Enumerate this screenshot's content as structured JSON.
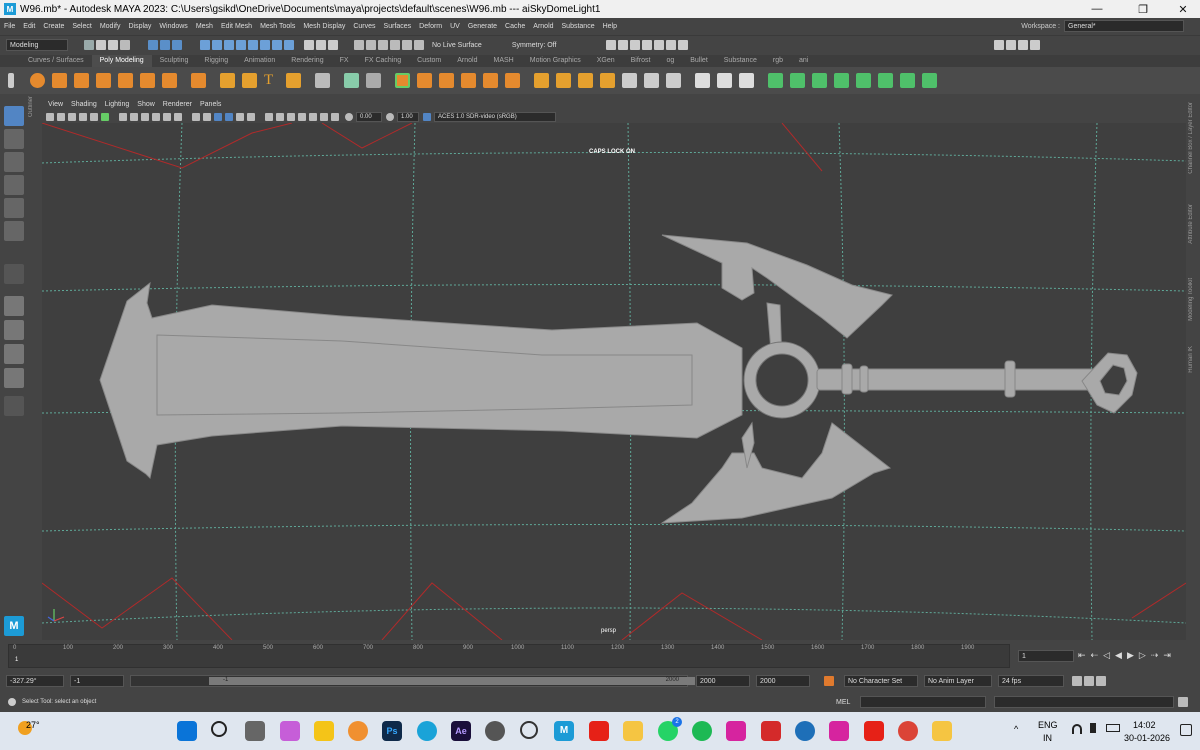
{
  "titlebar": {
    "title": "W96.mb* - Autodesk MAYA 2023: C:\\Users\\gsikd\\OneDrive\\Documents\\maya\\projects\\default\\scenes\\W96.mb   ---   aiSkyDomeLight1",
    "logo": "M",
    "minimize": "—",
    "maximize": "❐",
    "close": "✕"
  },
  "menubar": {
    "items": [
      "File",
      "Edit",
      "Create",
      "Select",
      "Modify",
      "Display",
      "Windows",
      "Mesh",
      "Edit Mesh",
      "Mesh Tools",
      "Mesh Display",
      "Curves",
      "Surfaces",
      "Deform",
      "UV",
      "Generate",
      "Cache",
      "Arnold",
      "Substance",
      "Help"
    ],
    "workspace_label": "Workspace :",
    "workspace_value": "General*"
  },
  "statusline": {
    "mode": "Modeling",
    "live_surface": "No Live Surface",
    "symmetry": "Symmetry: Off"
  },
  "shelf": {
    "tabs": [
      "Curves / Surfaces",
      "Poly Modeling",
      "Sculpting",
      "Rigging",
      "Animation",
      "Rendering",
      "FX",
      "FX Caching",
      "Custom",
      "Arnold",
      "MASH",
      "Motion Graphics",
      "XGen",
      "Bifrost",
      "og",
      "Bullet",
      "Substance",
      "rgb",
      "ani"
    ],
    "active_tab": "Poly Modeling"
  },
  "panel": {
    "menus": [
      "View",
      "Shading",
      "Lighting",
      "Show",
      "Renderer",
      "Panels"
    ],
    "exposure": "0.00",
    "gamma": "1.00",
    "color_space": "ACES 1.0 SDR-video (sRGB)"
  },
  "viewport": {
    "caps_lock": "CAPS LOCK ON",
    "camera": "persp",
    "model_color": "#a9a9a9",
    "grid_color": "#5fa898",
    "light_color": "#b02a2a"
  },
  "side_labels": {
    "outliner": "Outliner",
    "channel_box": "Channel Box / Layer Editor",
    "attribute_editor": "Attribute Editor",
    "modeling_toolkit": "Modeling Toolkit",
    "human_ik": "Human IK"
  },
  "timeslider": {
    "ticks": [
      "0",
      "100",
      "200",
      "300",
      "400",
      "500",
      "600",
      "700",
      "800",
      "900",
      "1000",
      "1100",
      "1200",
      "1300",
      "1400",
      "1500",
      "1600",
      "1700",
      "1800",
      "1900"
    ],
    "current_frame_marker": "1",
    "current_frame": "1"
  },
  "range": {
    "rotate_value": "-327.29°",
    "start": "-1",
    "range_start": "-1",
    "range_end": "2000",
    "end": "2000",
    "end2": "2000",
    "character_set": "No Character Set",
    "anim_layer": "No Anim Layer",
    "fps": "24 fps"
  },
  "cmdline": {
    "lang": "MEL",
    "help": "Select Tool: select an object"
  },
  "taskbar": {
    "temperature": "27°",
    "lang1": "ENG",
    "lang2": "IN",
    "time": "14:02",
    "date": "30-01-2026",
    "whatsapp_badge": "2"
  }
}
